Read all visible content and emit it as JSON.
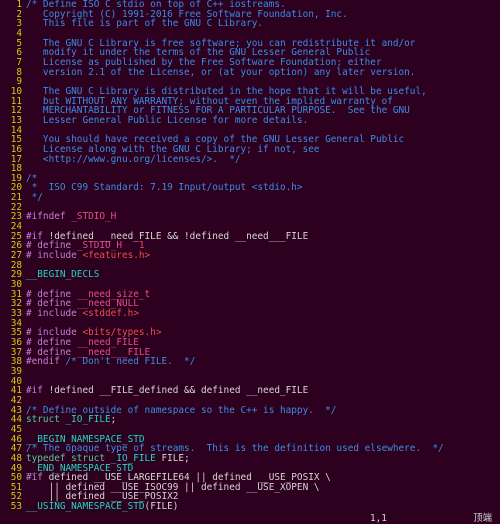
{
  "status": {
    "position": "1,1",
    "label": "顶端"
  },
  "lines": [
    {
      "n": 1,
      "t": [
        [
          "c-comment",
          "/* Define ISO C stdio on top of C++ iostreams."
        ]
      ]
    },
    {
      "n": 2,
      "t": [
        [
          "c-comment",
          "   Copyright (C) 1991-2016 Free Software Foundation, Inc."
        ]
      ]
    },
    {
      "n": 3,
      "t": [
        [
          "c-comment",
          "   This file is part of the GNU C Library."
        ]
      ]
    },
    {
      "n": 4,
      "t": []
    },
    {
      "n": 5,
      "t": [
        [
          "c-comment",
          "   The GNU C Library is free software; you can redistribute it and/or"
        ]
      ]
    },
    {
      "n": 6,
      "t": [
        [
          "c-comment",
          "   modify it under the terms of the GNU Lesser General Public"
        ]
      ]
    },
    {
      "n": 7,
      "t": [
        [
          "c-comment",
          "   License as published by the Free Software Foundation; either"
        ]
      ]
    },
    {
      "n": 8,
      "t": [
        [
          "c-comment",
          "   version 2.1 of the License, or (at your option) any later version."
        ]
      ]
    },
    {
      "n": 9,
      "t": []
    },
    {
      "n": 10,
      "t": [
        [
          "c-comment",
          "   The GNU C Library is distributed in the hope that it will be useful,"
        ]
      ]
    },
    {
      "n": 11,
      "t": [
        [
          "c-comment",
          "   but WITHOUT ANY WARRANTY; without even the implied warranty of"
        ]
      ]
    },
    {
      "n": 12,
      "t": [
        [
          "c-comment",
          "   MERCHANTABILITY or FITNESS FOR A PARTICULAR PURPOSE.  See the GNU"
        ]
      ]
    },
    {
      "n": 13,
      "t": [
        [
          "c-comment",
          "   Lesser General Public License for more details."
        ]
      ]
    },
    {
      "n": 14,
      "t": []
    },
    {
      "n": 15,
      "t": [
        [
          "c-comment",
          "   You should have received a copy of the GNU Lesser General Public"
        ]
      ]
    },
    {
      "n": 16,
      "t": [
        [
          "c-comment",
          "   License along with the GNU C Library; if not, see"
        ]
      ]
    },
    {
      "n": 17,
      "t": [
        [
          "c-comment",
          "   <http://www.gnu.org/licenses/>.  */"
        ]
      ]
    },
    {
      "n": 18,
      "t": []
    },
    {
      "n": 19,
      "t": [
        [
          "c-comment",
          "/*"
        ]
      ]
    },
    {
      "n": 20,
      "t": [
        [
          "c-comment",
          " *  ISO C99 Standard: 7.19 Input/output <stdio.h>"
        ]
      ]
    },
    {
      "n": 21,
      "t": [
        [
          "c-comment",
          " */"
        ]
      ]
    },
    {
      "n": 22,
      "t": []
    },
    {
      "n": 23,
      "t": [
        [
          "c-key",
          "#ifndef "
        ],
        [
          "c-ident",
          "_STDIO_H"
        ]
      ]
    },
    {
      "n": 24,
      "t": []
    },
    {
      "n": 25,
      "t": [
        [
          "c-key",
          "#if"
        ],
        [
          "c-plain",
          " !defined __need_FILE && !defined __need___FILE"
        ]
      ]
    },
    {
      "n": 26,
      "t": [
        [
          "c-key",
          "# define "
        ],
        [
          "c-ident",
          "_STDIO_H   "
        ],
        [
          "c-string",
          "1"
        ]
      ]
    },
    {
      "n": 27,
      "t": [
        [
          "c-key",
          "# include "
        ],
        [
          "c-string",
          "<features.h>"
        ]
      ]
    },
    {
      "n": 28,
      "t": []
    },
    {
      "n": 29,
      "t": [
        [
          "c-inc",
          "__BEGIN_DECLS"
        ]
      ]
    },
    {
      "n": 30,
      "t": []
    },
    {
      "n": 31,
      "t": [
        [
          "c-key",
          "# define "
        ],
        [
          "c-ident",
          "__need_size_t"
        ]
      ]
    },
    {
      "n": 32,
      "t": [
        [
          "c-key",
          "# define "
        ],
        [
          "c-ident",
          "__need_NULL"
        ]
      ]
    },
    {
      "n": 33,
      "t": [
        [
          "c-key",
          "# include "
        ],
        [
          "c-string",
          "<stddef.h>"
        ]
      ]
    },
    {
      "n": 34,
      "t": []
    },
    {
      "n": 35,
      "t": [
        [
          "c-key",
          "# include "
        ],
        [
          "c-string",
          "<bits/types.h>"
        ]
      ]
    },
    {
      "n": 36,
      "t": [
        [
          "c-key",
          "# define "
        ],
        [
          "c-ident",
          "__need_FILE"
        ]
      ]
    },
    {
      "n": 37,
      "t": [
        [
          "c-key",
          "# define "
        ],
        [
          "c-ident",
          "__need___FILE"
        ]
      ]
    },
    {
      "n": 38,
      "t": [
        [
          "c-key",
          "#endif"
        ],
        [
          "c-plain",
          " "
        ],
        [
          "c-comment",
          "/* Don't need FILE.  */"
        ]
      ]
    },
    {
      "n": 39,
      "t": []
    },
    {
      "n": 40,
      "t": []
    },
    {
      "n": 41,
      "t": [
        [
          "c-key",
          "#if"
        ],
        [
          "c-plain",
          " !defined __FILE_defined && defined __need_FILE"
        ]
      ]
    },
    {
      "n": 42,
      "t": []
    },
    {
      "n": 43,
      "t": [
        [
          "c-comment",
          "/* Define outside of namespace so the C++ is happy.  */"
        ]
      ]
    },
    {
      "n": 44,
      "t": [
        [
          "c-type",
          "struct "
        ],
        [
          "c-inc",
          "_IO_FILE"
        ],
        [
          "c-op",
          ";"
        ]
      ]
    },
    {
      "n": 45,
      "t": []
    },
    {
      "n": 46,
      "t": [
        [
          "c-inc",
          "__BEGIN_NAMESPACE_STD"
        ]
      ]
    },
    {
      "n": 47,
      "t": [
        [
          "c-comment",
          "/* The opaque type of streams.  This is the definition used elsewhere.  */"
        ]
      ]
    },
    {
      "n": 48,
      "t": [
        [
          "c-type",
          "typedef struct "
        ],
        [
          "c-inc",
          "_IO_FILE"
        ],
        [
          "c-plain",
          " FILE"
        ],
        [
          "c-op",
          ";"
        ]
      ]
    },
    {
      "n": 49,
      "t": [
        [
          "c-inc",
          "__END_NAMESPACE_STD"
        ]
      ]
    },
    {
      "n": 50,
      "t": [
        [
          "c-key",
          "#if"
        ],
        [
          "c-plain",
          " defined __USE_LARGEFILE64 || defined __USE_POSIX \\"
        ]
      ]
    },
    {
      "n": 51,
      "t": [
        [
          "c-plain",
          "    || defined __USE_ISOC99 || defined __USE_XOPEN \\"
        ]
      ]
    },
    {
      "n": 52,
      "t": [
        [
          "c-plain",
          "    || defined __USE_POSIX2"
        ]
      ]
    },
    {
      "n": 53,
      "t": [
        [
          "c-inc",
          "__USING_NAMESPACE_STD"
        ],
        [
          "c-op",
          "("
        ],
        [
          "c-plain",
          "FILE"
        ],
        [
          "c-op",
          ")"
        ]
      ]
    }
  ]
}
